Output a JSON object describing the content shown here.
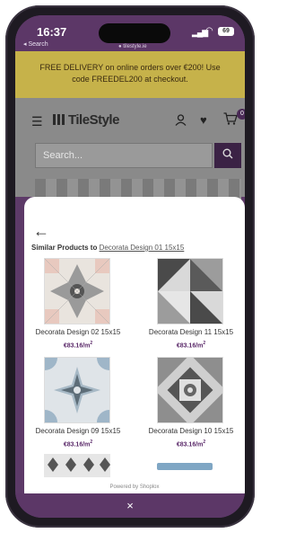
{
  "status_bar": {
    "time": "16:37",
    "back_label": "◂ Search",
    "url": "● tilestyle.ie",
    "battery": "69"
  },
  "banner": {
    "text_line1": "FREE DELIVERY on online orders over €200! Use",
    "text_line2": "code FREEDEL200 at checkout."
  },
  "header": {
    "logo": "TileStyle",
    "cart_count": "0",
    "search_placeholder": "Search..."
  },
  "sheet": {
    "similar_prefix": "Similar Products to ",
    "similar_link": "Decorata Design 01 15x15",
    "products": [
      {
        "name": "Decorata Design 02 15x15",
        "price": "€83.16/m",
        "unit_sup": "2"
      },
      {
        "name": "Decorata Design 11 15x15",
        "price": "€83.16/m",
        "unit_sup": "2"
      },
      {
        "name": "Decorata Design 09 15x15",
        "price": "€83.16/m",
        "unit_sup": "2"
      },
      {
        "name": "Decorata Design 10 15x15",
        "price": "€83.16/m",
        "unit_sup": "2"
      }
    ],
    "powered_by": "Powered by Shoplox"
  },
  "close_label": "×",
  "colors": {
    "brand": "#5c3767",
    "banner": "#c6b24a",
    "price": "#5b2a6a"
  }
}
